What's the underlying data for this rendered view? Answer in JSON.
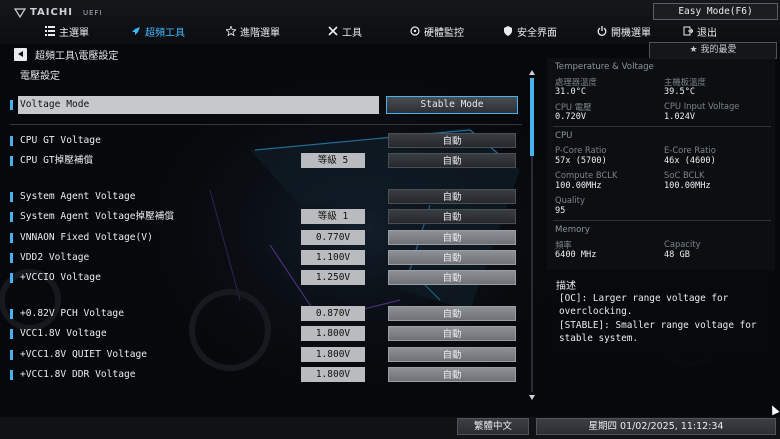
{
  "header": {
    "brand": "TAICHI",
    "brand_suffix": "UEFI",
    "easy_mode_label": "Easy Mode(F6)",
    "nav": [
      {
        "label": "主選單",
        "icon": "menu-icon",
        "active": false
      },
      {
        "label": "超頻工具",
        "icon": "rocket-icon",
        "active": true
      },
      {
        "label": "進階選單",
        "icon": "star-icon",
        "active": false
      },
      {
        "label": "工具",
        "icon": "tools-icon",
        "active": false
      },
      {
        "label": "硬體監控",
        "icon": "monitor-icon",
        "active": false
      },
      {
        "label": "安全界面",
        "icon": "shield-icon",
        "active": false
      },
      {
        "label": "開機選單",
        "icon": "power-icon",
        "active": false
      },
      {
        "label": "退出",
        "icon": "exit-icon",
        "active": false
      }
    ]
  },
  "breadcrumb": "超頻工具\\電壓設定",
  "page_title": "電壓設定",
  "favorite_label": "我的最愛",
  "settings": [
    {
      "label": "Voltage Mode",
      "value": "",
      "option": "Stable Mode",
      "selected": true,
      "dim": false
    },
    {
      "label": "CPU GT Voltage",
      "value": "",
      "option": "自動",
      "selected": false,
      "dim": false
    },
    {
      "label": "CPU GT掉壓補償",
      "value": "等級 5",
      "option": "自動",
      "selected": false,
      "dim": false
    },
    {
      "label": "System Agent Voltage",
      "value": "",
      "option": "自動",
      "selected": false,
      "dim": false
    },
    {
      "label": "System Agent Voltage掉壓補償",
      "value": "等級 1",
      "option": "自動",
      "selected": false,
      "dim": false
    },
    {
      "label": "VNNAON Fixed Voltage(V)",
      "value": "0.770V",
      "option": "自動",
      "selected": false,
      "dim": true
    },
    {
      "label": "VDD2 Voltage",
      "value": "1.100V",
      "option": "自動",
      "selected": false,
      "dim": true
    },
    {
      "label": "+VCCIO Voltage",
      "value": "1.250V",
      "option": "自動",
      "selected": false,
      "dim": true
    },
    {
      "label": "+0.82V PCH Voltage",
      "value": "0.870V",
      "option": "自動",
      "selected": false,
      "dim": true
    },
    {
      "label": "VCC1.8V Voltage",
      "value": "1.800V",
      "option": "自動",
      "selected": false,
      "dim": true
    },
    {
      "label": "+VCC1.8V QUIET Voltage",
      "value": "1.800V",
      "option": "自動",
      "selected": false,
      "dim": true
    },
    {
      "label": "+VCC1.8V DDR Voltage",
      "value": "1.800V",
      "option": "自動",
      "selected": false,
      "dim": true
    }
  ],
  "monitor": {
    "temp_section": "Temperature & Voltage",
    "cpu_temp_label": "處理器溫度",
    "cpu_temp": "31.0°C",
    "mb_temp_label": "主機板溫度",
    "mb_temp": "39.5°C",
    "cpu_volt_label": "CPU 電壓",
    "cpu_volt": "0.720V",
    "cpu_input_label": "CPU Input Voltage",
    "cpu_input": "1.024V",
    "cpu_section": "CPU",
    "pcore_label": "P-Core Ratio",
    "pcore": "57x (5700)",
    "ecore_label": "E-Core Ratio",
    "ecore": "46x (4600)",
    "bclk_label": "Compute BCLK",
    "bclk": "100.00MHz",
    "socbclk_label": "SoC BCLK",
    "socbclk": "100.00MHz",
    "quality_label": "Quality",
    "quality": "95",
    "mem_section": "Memory",
    "freq_label": "頻率",
    "freq": "6400 MHz",
    "cap_label": "Capacity",
    "cap": "48 GB"
  },
  "description": {
    "title": "描述",
    "body": "[OC]: Larger range voltage for overclocking.\n[STABLE]: Smaller range voltage for stable system."
  },
  "footer": {
    "language": "繁體中文",
    "datetime": "星期四 01/02/2025, 11:12:34"
  },
  "colors": {
    "accent": "#46b2f0",
    "active_tab": "#3fb7ff"
  }
}
